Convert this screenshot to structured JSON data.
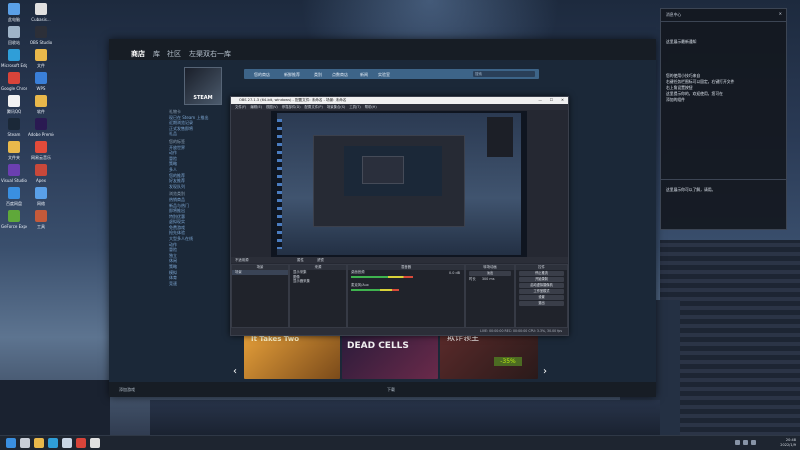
{
  "desktop": {
    "icons": [
      {
        "label": "此电脑",
        "color": "#5aa0e8"
      },
      {
        "label": "Cubasis...",
        "color": "#e0e0e0"
      },
      {
        "label": "回收站",
        "color": "#9fb4c8"
      },
      {
        "label": "OBS Studio",
        "color": "#2c2f38"
      },
      {
        "label": "Microsoft Edge",
        "color": "#2f9ed8"
      },
      {
        "label": "文件",
        "color": "#e9b84b"
      },
      {
        "label": "Google Chrome",
        "color": "#d8443a"
      },
      {
        "label": "WPS",
        "color": "#3a7fd8"
      },
      {
        "label": "腾讯QQ",
        "color": "#f2f2f2"
      },
      {
        "label": "软件",
        "color": "#e9b84b"
      },
      {
        "label": "Steam",
        "color": "#1b2838"
      },
      {
        "label": "Adobe Premiere",
        "color": "#2a1a52"
      },
      {
        "label": "文件夹",
        "color": "#e9b84b"
      },
      {
        "label": "网易云音乐",
        "color": "#e34b3a"
      },
      {
        "label": "Visual Studio",
        "color": "#6b3fb0"
      },
      {
        "label": "Apex",
        "color": "#c8483a"
      },
      {
        "label": "百度网盘",
        "color": "#3a8fe0"
      },
      {
        "label": "网络",
        "color": "#5aa0e8"
      },
      {
        "label": "GeForce Experience",
        "color": "#5fa83a"
      },
      {
        "label": "工具",
        "color": "#c45a3a"
      },
      {
        "label": "控制面板",
        "color": "#3a8fe0"
      }
    ]
  },
  "steam": {
    "nav": [
      "商店",
      "库",
      "社区",
      "左渠双右一库"
    ],
    "store_bar": [
      "您的商店",
      "新鲜推荐",
      "类别",
      "点数商店",
      "新闻",
      "实验室"
    ],
    "search_placeholder": "搜索",
    "logo_text": "STEAM",
    "sidebar": {
      "sections": [
        {
          "header": "礼物卡",
          "items": [
            "现已在 Steam 上推出"
          ]
        },
        {
          "header": "",
          "items": [
            "近期浏览记录",
            "正式发售即将",
            "礼品"
          ]
        },
        {
          "header": "您的标签",
          "items": [
            "开放世界",
            "动作",
            "冒险",
            "策略",
            "多人"
          ]
        },
        {
          "header": "",
          "items": [
            "您的推荐",
            "好友推荐",
            "发现队列"
          ]
        },
        {
          "header": "浏览类别",
          "items": [
            "热销商品",
            "新品与热门",
            "即将推出",
            "特别优惠",
            "虚拟现实",
            "免费游戏",
            "抢先体验"
          ]
        },
        {
          "header": "",
          "items": [
            "大型多人在线",
            "动作",
            "冒险",
            "独立",
            "休闲"
          ]
        },
        {
          "header": "",
          "items": [
            "策略",
            "模拟",
            "体育",
            "竞速"
          ]
        }
      ]
    },
    "games": [
      {
        "title": "It Takes Two",
        "color": "#e6a03a"
      },
      {
        "title": "DEAD CELLS",
        "color": "#2a1b3a"
      },
      {
        "title": "欺诈领主",
        "color": "#5a2a2a"
      }
    ],
    "discount": "-35%",
    "footer_left": "添加游戏",
    "footer_center": "下载"
  },
  "obs": {
    "title": "OBS 27.1.3 (64-bit, windows) - 配置文件: 未命名 - 场景: 未命名",
    "menu": [
      "文件(F)",
      "编辑(E)",
      "视图(V)",
      "停靠部件(D)",
      "配置文件(P)",
      "场景集合(S)",
      "工具(T)",
      "帮助(H)"
    ],
    "bar_left": "不适用源",
    "bar_items": [
      "属性",
      "滤镜"
    ],
    "docks": {
      "scenes": {
        "title": "场景",
        "items": [
          "场景"
        ]
      },
      "sources": {
        "title": "来源",
        "items": [
          "显示采集",
          "图像",
          "显示器采集"
        ]
      },
      "mixer": {
        "title": "混音器",
        "channels": [
          "桌面音频",
          "麦克风/Aux"
        ],
        "levels": [
          0.62,
          0.48
        ],
        "db": "0.0 dB"
      },
      "transitions": {
        "title": "转场动画",
        "type": "淡出",
        "duration_label": "时长",
        "duration": "300 ms"
      },
      "controls": {
        "title": "控件",
        "buttons": [
          "停止推流",
          "开始录制",
          "启动虚拟摄像机",
          "工作室模式",
          "设置",
          "退出"
        ]
      }
    },
    "status": "LIVE: 00:00:00  REC: 00:00:00  CPU: 3.3%, 30.00 fps"
  },
  "panel": {
    "header": "消息中心",
    "lines": [
      "这里展示最新通知",
      "您的使用小技巧来自",
      "右键任务栏图标可以固定，右键打开文件",
      "右上角设置按钮",
      "这里提示你的，欢迎使用，您可在",
      "添加的组件",
      "这里展示你可以了解，请用。"
    ]
  },
  "taskbar": {
    "time": "20:48",
    "date": "2022/1/9",
    "apps": [
      "start",
      "search",
      "explorer",
      "edge",
      "steam",
      "obs",
      "chrome"
    ],
    "app_colors": [
      "#3a8fe0",
      "#c8ced8",
      "#e9b84b",
      "#2f9ed8",
      "#c9d6e6",
      "#d8443a",
      "#e0e0e0"
    ]
  }
}
